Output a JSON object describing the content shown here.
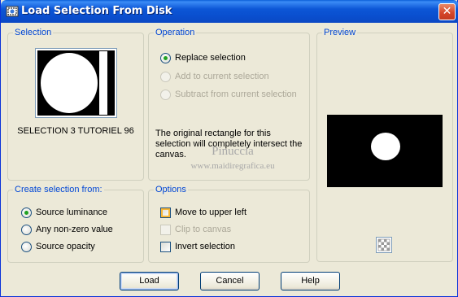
{
  "window": {
    "title": "Load Selection From Disk",
    "close_glyph": "✕"
  },
  "selection_group": {
    "label": "Selection",
    "name": "SELECTION 3 TUTORIEL 96"
  },
  "operation_group": {
    "label": "Operation",
    "options": [
      {
        "label": "Replace selection",
        "checked": true,
        "enabled": true
      },
      {
        "label": "Add to current selection",
        "checked": false,
        "enabled": false
      },
      {
        "label": "Subtract from current selection",
        "checked": false,
        "enabled": false
      }
    ],
    "info": "The original rectangle for this selection will completely intersect the canvas."
  },
  "watermark": {
    "line1": "Pinuccia",
    "line2": "www.maidiregrafica.eu"
  },
  "preview_group": {
    "label": "Preview"
  },
  "create_group": {
    "label": "Create selection from:",
    "options": [
      {
        "label": "Source luminance",
        "checked": true
      },
      {
        "label": "Any non-zero value",
        "checked": false
      },
      {
        "label": "Source opacity",
        "checked": false
      }
    ]
  },
  "options_group": {
    "label": "Options",
    "items": [
      {
        "label": "Move to upper left",
        "checked": false,
        "enabled": true
      },
      {
        "label": "Clip to canvas",
        "checked": false,
        "enabled": false
      },
      {
        "label": "Invert selection",
        "checked": false,
        "enabled": true
      }
    ]
  },
  "buttons": {
    "load": "Load",
    "cancel": "Cancel",
    "help": "Help"
  },
  "colors": {
    "accent_label": "#0046d5",
    "titlebar": "#0a4fcf",
    "radio_dot": "#21a121"
  },
  "icons": {
    "title": "selection-app-icon",
    "close": "close-icon",
    "checker": "transparency-checker-icon"
  }
}
